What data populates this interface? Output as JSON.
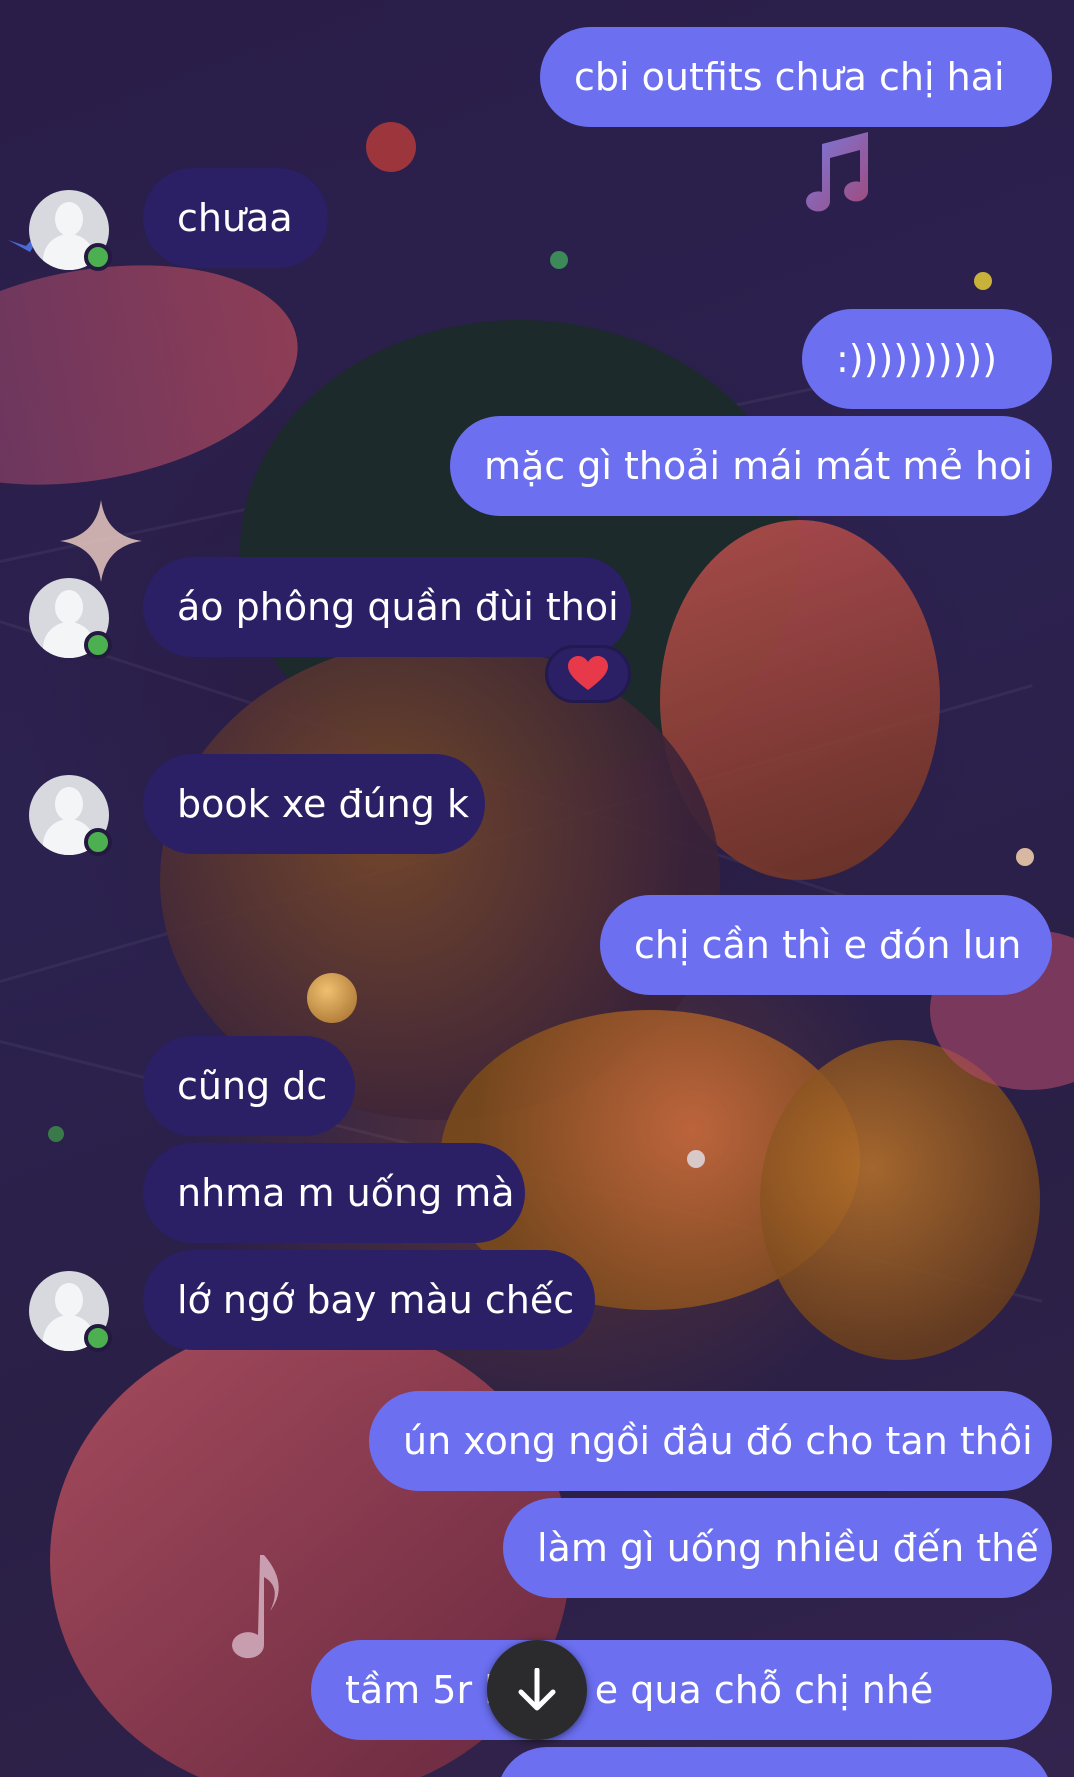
{
  "conversation": {
    "messages": [
      {
        "direction": "out",
        "text": "cbi outfits chưa chị hai"
      },
      {
        "direction": "in",
        "text": "chưaa"
      },
      {
        "direction": "out",
        "text": ":))))))))))"
      },
      {
        "direction": "out",
        "text": "mặc gì thoải mái mát mẻ hoi"
      },
      {
        "direction": "in",
        "text": "áo phông quần đùi thoi",
        "reaction": "heart"
      },
      {
        "direction": "in",
        "text": "book xe đúng k"
      },
      {
        "direction": "out",
        "text": "chị cần thì e đón lun"
      },
      {
        "direction": "in",
        "text": "cũng dc"
      },
      {
        "direction": "in",
        "text": "nhma m uống mà"
      },
      {
        "direction": "in",
        "text": "lớ ngớ bay màu chếc"
      },
      {
        "direction": "out",
        "text": "ún xong ngồi đâu đó cho tan thôi"
      },
      {
        "direction": "out",
        "text": "làm gì uống nhiều đến thế"
      },
      {
        "direction": "out",
        "text": "tầm 5r       làm r e qua chỗ chị nhé"
      }
    ]
  },
  "colors": {
    "outgoing_bubble": "#6b6ff0",
    "incoming_bubble": "#2b1f66",
    "online_indicator": "#4caf50",
    "background": "#24193f"
  },
  "icons": {
    "avatar": "default-user-avatar",
    "reaction": "heart-icon",
    "scroll": "arrow-down-icon"
  }
}
